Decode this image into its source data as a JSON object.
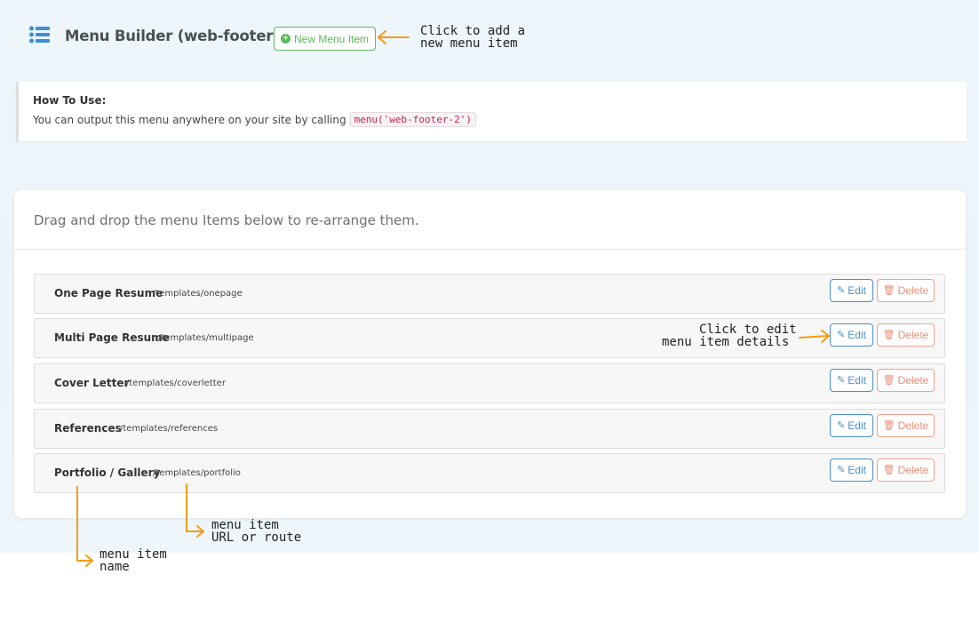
{
  "header": {
    "title": "Menu Builder (web-footer-2)",
    "new_button_label": "New Menu Item",
    "menu_icon": "list-icon"
  },
  "howto": {
    "title": "How To Use:",
    "text": "You can output this menu anywhere on your site by calling",
    "code": "menu('web-footer-2')"
  },
  "card": {
    "instructions": "Drag and drop the menu Items below to re-arrange them."
  },
  "menu_items": [
    {
      "name": "One Page Resume",
      "url": "/templates/onepage"
    },
    {
      "name": "Multi Page Resume",
      "url": "/templates/multipage"
    },
    {
      "name": "Cover Letter",
      "url": "/templates/coverletter"
    },
    {
      "name": "References",
      "url": "/templates/references"
    },
    {
      "name": "Portfolio / Gallery",
      "url": "/templates/portfolio"
    }
  ],
  "actions": {
    "edit_label": "Edit",
    "delete_label": "Delete",
    "edit_icon": "pencil-icon",
    "delete_icon": "trash-icon"
  },
  "annotations": {
    "new_item_line1": "Click to add a",
    "new_item_line2": "new menu item",
    "edit_line1": "Click to edit",
    "edit_line2": "menu item details",
    "url_line1": "menu item",
    "url_line2": "URL or route",
    "name_line1": "menu item",
    "name_line2": "name"
  },
  "colors": {
    "accent_green": "#5cb85c",
    "edit_blue": "#4a90c8",
    "delete_red": "#ee8f7a",
    "annotation_orange": "#f39c12"
  }
}
